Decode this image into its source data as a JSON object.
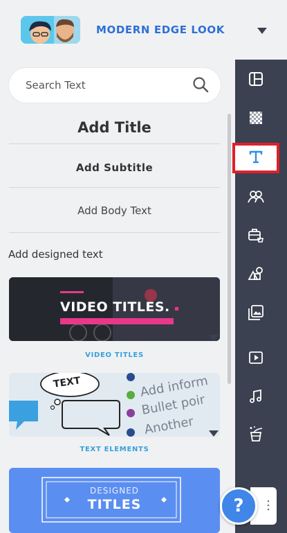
{
  "header": {
    "project_title": "MODERN EDGE LOOK",
    "avatar_icon": "team-avatar-icon",
    "dropdown_icon": "caret-down-icon"
  },
  "search": {
    "placeholder": "Search Text",
    "value": "",
    "icon": "search-icon"
  },
  "text_options": {
    "title": "Add Title",
    "subtitle": "Add Subtitle",
    "body": "Add Body Text"
  },
  "designed": {
    "section_label": "Add designed text",
    "cards": [
      {
        "caption": "VIDEO TITLES",
        "preview_text": "VIDEO TITLES."
      },
      {
        "caption": "TEXT ELEMENTS",
        "preview_bubble": "TEXT",
        "preview_lines": [
          "Add inform",
          "Bullet poir",
          "Another"
        ]
      },
      {
        "caption": "",
        "preview_line1": "DESIGNED",
        "preview_line2": "TITLES"
      }
    ]
  },
  "toolbar": {
    "items": [
      {
        "icon": "layout-icon",
        "active": false
      },
      {
        "icon": "background-pattern-icon",
        "active": false
      },
      {
        "icon": "text-icon",
        "active": true
      },
      {
        "icon": "characters-icon",
        "active": false
      },
      {
        "icon": "props-icon",
        "active": false
      },
      {
        "icon": "shapes-icon",
        "active": false
      },
      {
        "icon": "image-icon",
        "active": false
      },
      {
        "icon": "video-icon",
        "active": false
      },
      {
        "icon": "music-icon",
        "active": false
      },
      {
        "icon": "effects-icon",
        "active": false
      }
    ]
  },
  "help": {
    "label": "?"
  },
  "colors": {
    "accent_blue": "#2f6fd7",
    "caption_blue": "#35a0dc",
    "toolbar_bg": "#3b4150",
    "active_outline": "#e0202a",
    "help_blue": "#3f86e8",
    "video_title_bar": "#e8388a"
  }
}
